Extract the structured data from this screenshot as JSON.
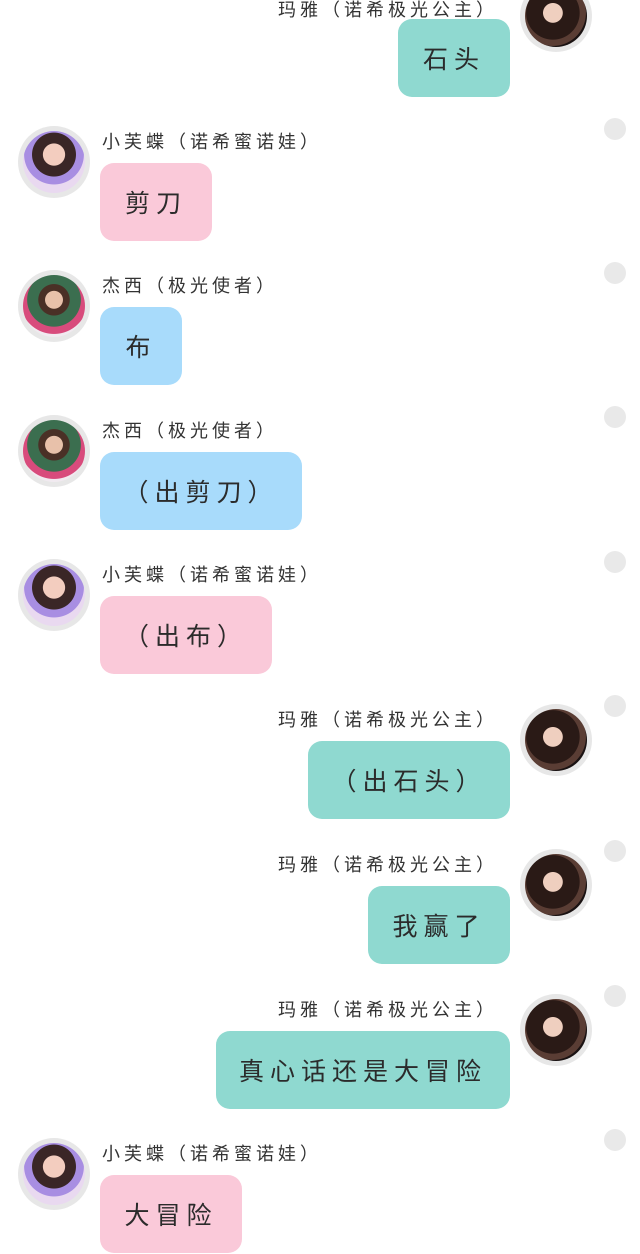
{
  "messages": [
    {
      "side": "right",
      "sender": "玛雅（诺希极光公主）",
      "text": "石头",
      "color": "#8fd9d0",
      "avatar": "maya-avatar"
    },
    {
      "side": "left",
      "sender": "小芙蝶（诺希蜜诺娃）",
      "text": "剪刀",
      "color": "#fac9d9",
      "avatar": "xiaofudie-avatar"
    },
    {
      "side": "left",
      "sender": "杰西（极光使者）",
      "text": "布",
      "color": "#a8dbfb",
      "avatar": "jiexi-avatar"
    },
    {
      "side": "left",
      "sender": "杰西（极光使者）",
      "text": "（出剪刀）",
      "color": "#a8dbfb",
      "avatar": "jiexi-avatar"
    },
    {
      "side": "left",
      "sender": "小芙蝶（诺希蜜诺娃）",
      "text": "（出布）",
      "color": "#fac9d9",
      "avatar": "xiaofudie-avatar"
    },
    {
      "side": "right",
      "sender": "玛雅（诺希极光公主）",
      "text": "（出石头）",
      "color": "#8fd9d0",
      "avatar": "maya-avatar"
    },
    {
      "side": "right",
      "sender": "玛雅（诺希极光公主）",
      "text": "我赢了",
      "color": "#8fd9d0",
      "avatar": "maya-avatar"
    },
    {
      "side": "right",
      "sender": "玛雅（诺希极光公主）",
      "text": "真心话还是大冒险",
      "color": "#8fd9d0",
      "avatar": "maya-avatar"
    },
    {
      "side": "left",
      "sender": "小芙蝶（诺希蜜诺娃）",
      "text": "大冒险",
      "color": "#fac9d9",
      "avatar": "xiaofudie-avatar"
    }
  ]
}
